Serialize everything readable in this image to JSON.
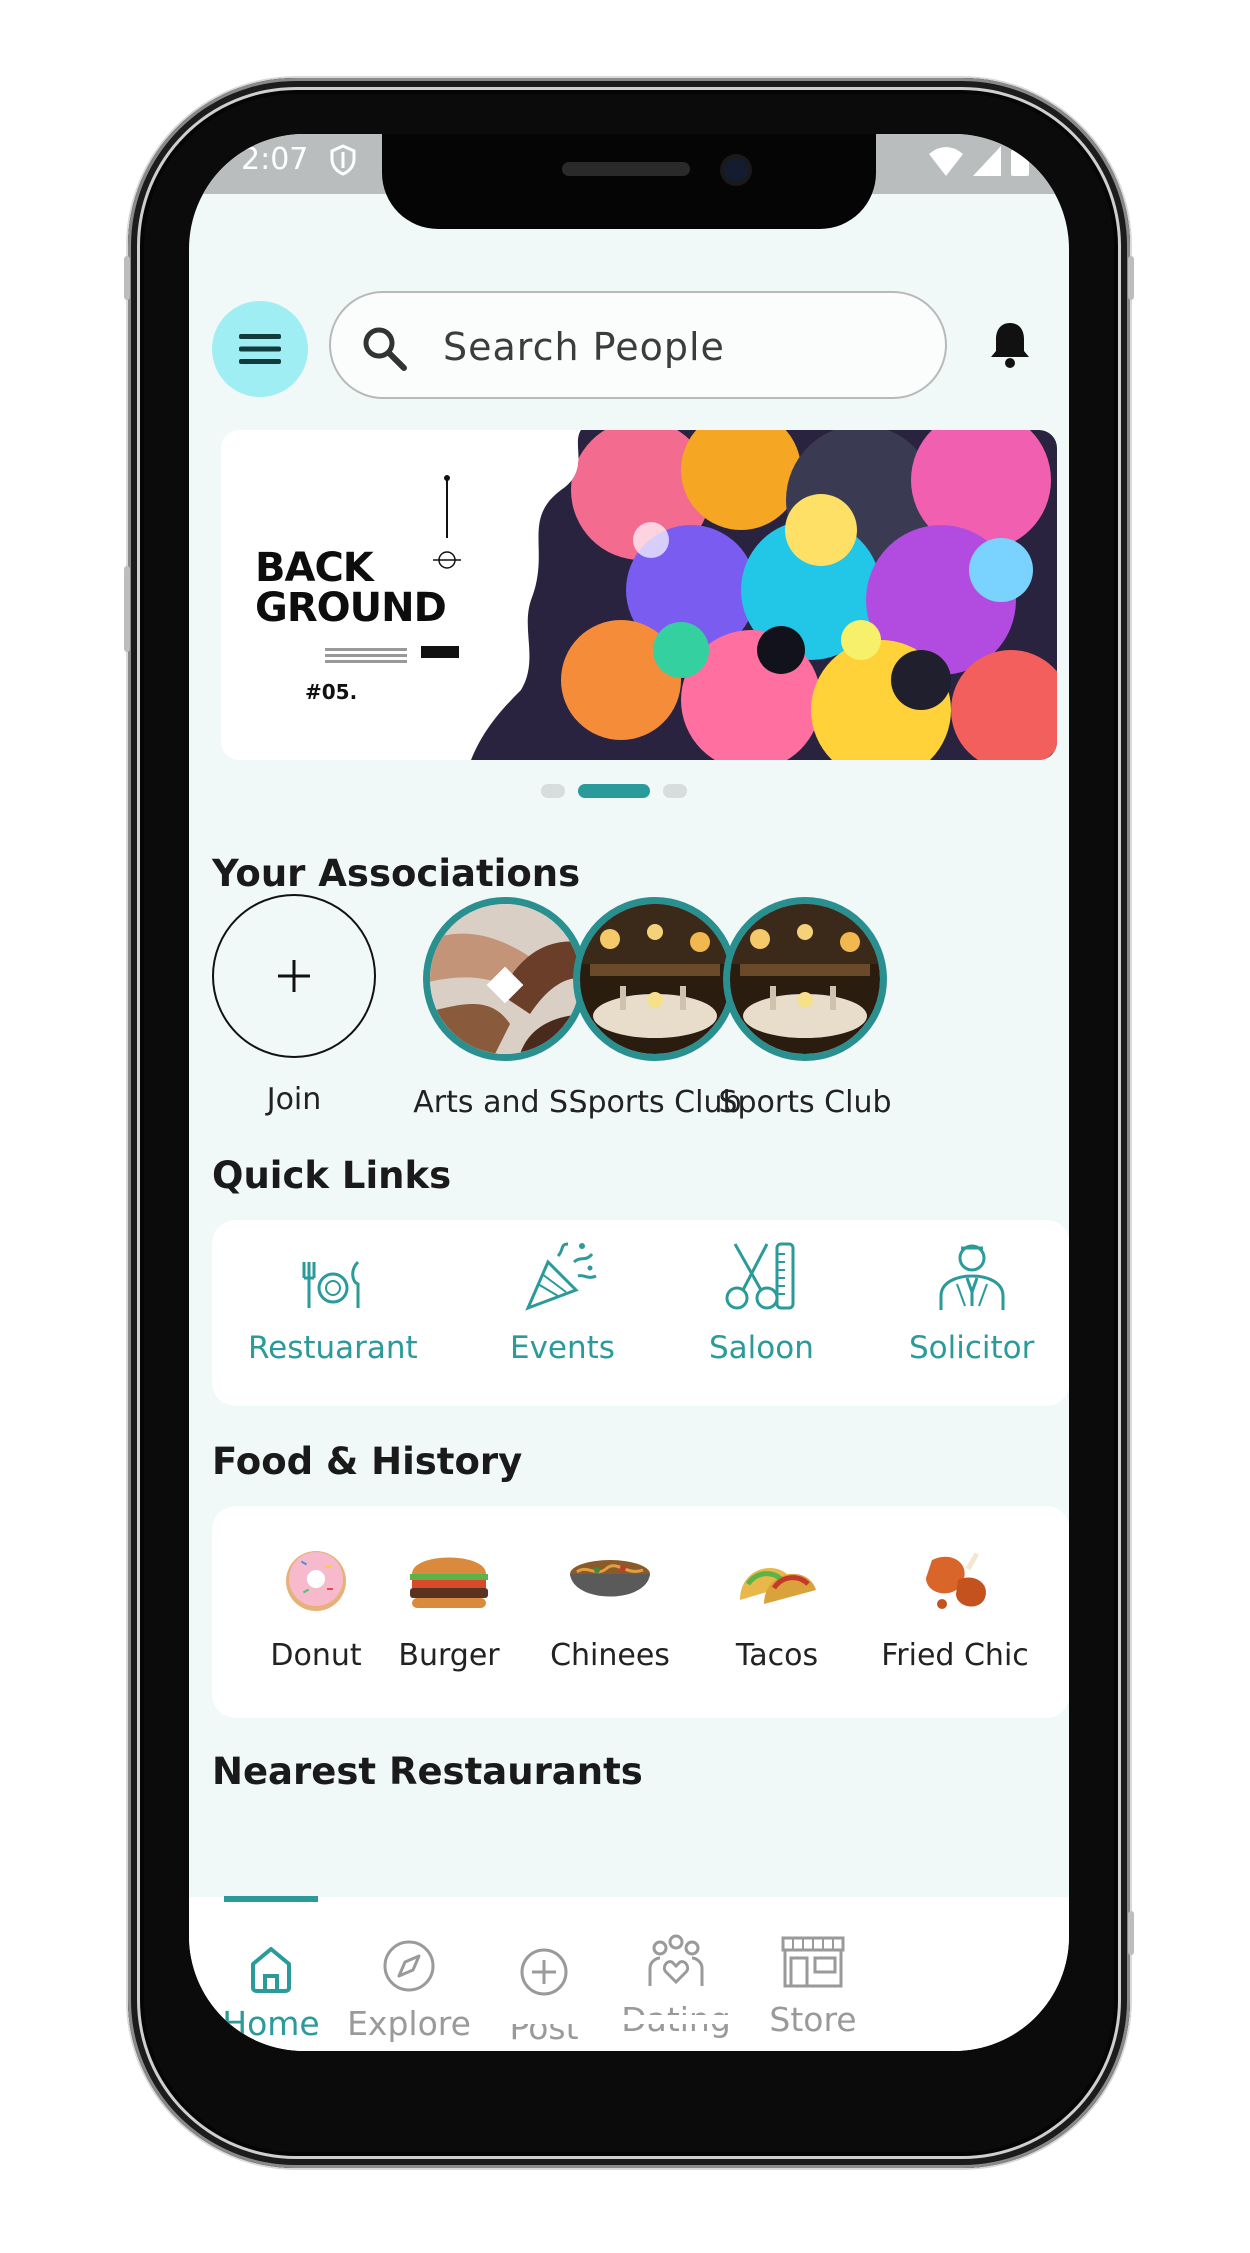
{
  "status_bar": {
    "time": "2:07"
  },
  "header": {
    "search_placeholder": "Search People"
  },
  "banner": {
    "title_line1": "BACK",
    "title_line2": "GROUND",
    "number": "#05.",
    "active_slide": 2,
    "slides": 3
  },
  "associations": {
    "title": "Your Associations",
    "items": [
      {
        "label": "Join"
      },
      {
        "label": "Arts and S..."
      },
      {
        "label": "Sports Club"
      },
      {
        "label": "Sports Club"
      }
    ]
  },
  "quick_links": {
    "title": "Quick Links",
    "items": [
      {
        "label": "Restuarant",
        "icon": "fork-knife-plate-icon"
      },
      {
        "label": "Events",
        "icon": "party-popper-icon"
      },
      {
        "label": "Saloon",
        "icon": "scissors-comb-icon"
      },
      {
        "label": "Solicitor",
        "icon": "lawyer-icon"
      }
    ]
  },
  "food_history": {
    "title": "Food & History",
    "items": [
      {
        "label": "Donut"
      },
      {
        "label": "Burger"
      },
      {
        "label": "Chinees"
      },
      {
        "label": "Tacos"
      },
      {
        "label": "Fried Chic"
      }
    ]
  },
  "nearest": {
    "title": "Nearest Restaurants"
  },
  "bottom_nav": {
    "items": [
      {
        "label": "Home",
        "icon": "home-icon"
      },
      {
        "label": "Explore",
        "icon": "compass-icon"
      },
      {
        "label": "Post",
        "icon": "plus-circle-icon"
      },
      {
        "label": "Dating",
        "icon": "dating-people-icon"
      },
      {
        "label": "Store",
        "icon": "storefront-icon"
      }
    ],
    "active": "Home"
  },
  "colors": {
    "accent": "#2a9a9a",
    "menu_bg": "#9eeef3",
    "screen_bg": "#f1f8f8"
  }
}
